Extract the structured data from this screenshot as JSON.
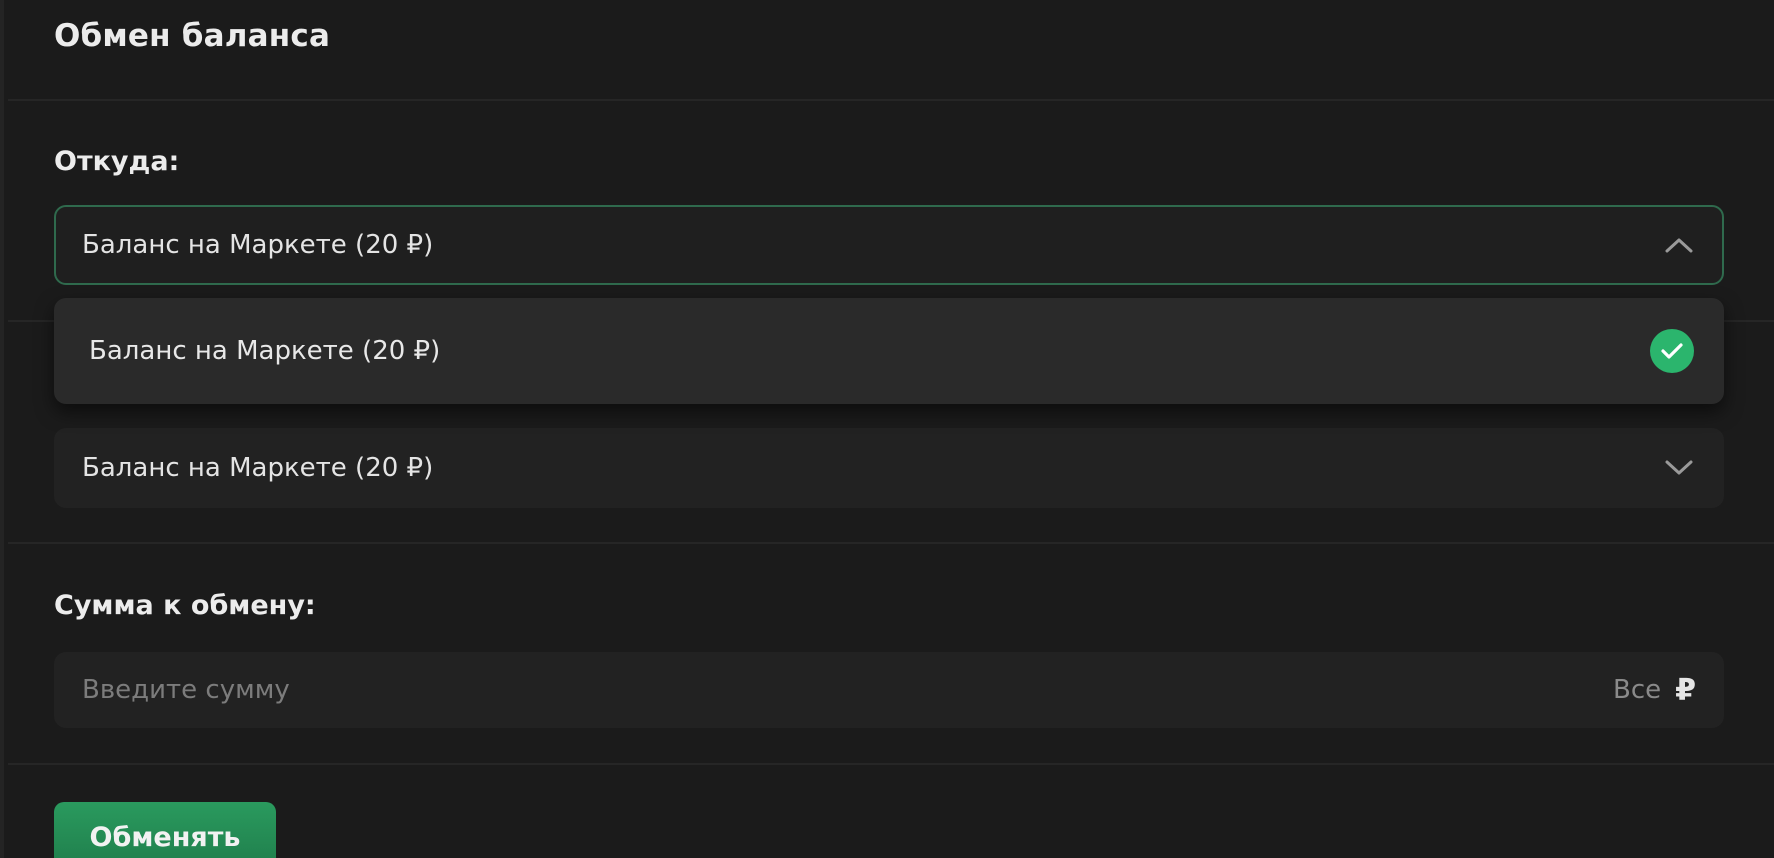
{
  "panel": {
    "title": "Обмен баланса"
  },
  "from": {
    "label": "Откуда:",
    "selected": "Баланс на Маркете (20 ₽)",
    "options": [
      {
        "label": "Баланс на Маркете (20 ₽)",
        "selected": true
      }
    ]
  },
  "to": {
    "selected": "Баланс на Маркете (20 ₽)"
  },
  "amount": {
    "label": "Сумма к обмену:",
    "placeholder": "Введите сумму",
    "all_label": "Все",
    "currency": "₽"
  },
  "submit": {
    "label": "Обменять"
  },
  "colors": {
    "accent": "#2bb56d",
    "focus_border": "#2f6a4d",
    "background": "#1b1b1b"
  },
  "icons": {
    "from_select": "chevron-up-icon",
    "to_select": "chevron-down-icon",
    "selected_option": "check-circle-icon"
  }
}
